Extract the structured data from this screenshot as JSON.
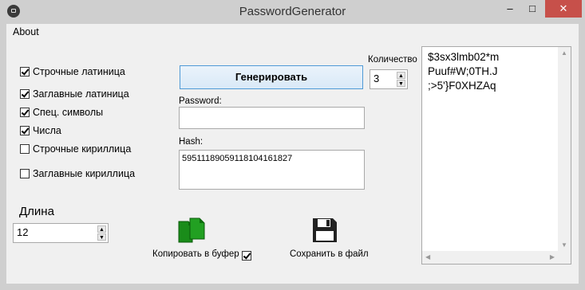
{
  "window": {
    "title": "PasswordGenerator",
    "minimize": "–",
    "maximize": "□",
    "close": "✕"
  },
  "menu": {
    "about": "About"
  },
  "options": [
    {
      "label": "Строчные латиница",
      "checked": true
    },
    {
      "label": "Заглавные латиница",
      "checked": true
    },
    {
      "label": "Спец. символы",
      "checked": true
    },
    {
      "label": "Числа",
      "checked": true
    },
    {
      "label": "Строчные кириллица",
      "checked": false
    },
    {
      "label": "Заглавные кириллица",
      "checked": false
    }
  ],
  "generate": {
    "label": "Генерировать"
  },
  "password": {
    "label": "Password:",
    "value": ""
  },
  "hash": {
    "label": "Hash:",
    "value": "5951118905911810416​1827"
  },
  "quantity": {
    "label": "Количество",
    "value": "3"
  },
  "length": {
    "label": "Длина",
    "value": "12"
  },
  "copy": {
    "label": "Копировать в буфер",
    "checked": true
  },
  "save": {
    "label": "Сохранить в файл"
  },
  "output": {
    "lines": [
      "$3sx3lmb02*m",
      "Puuf#W;0TH.J",
      ";>5'}F0XHZAq"
    ]
  }
}
